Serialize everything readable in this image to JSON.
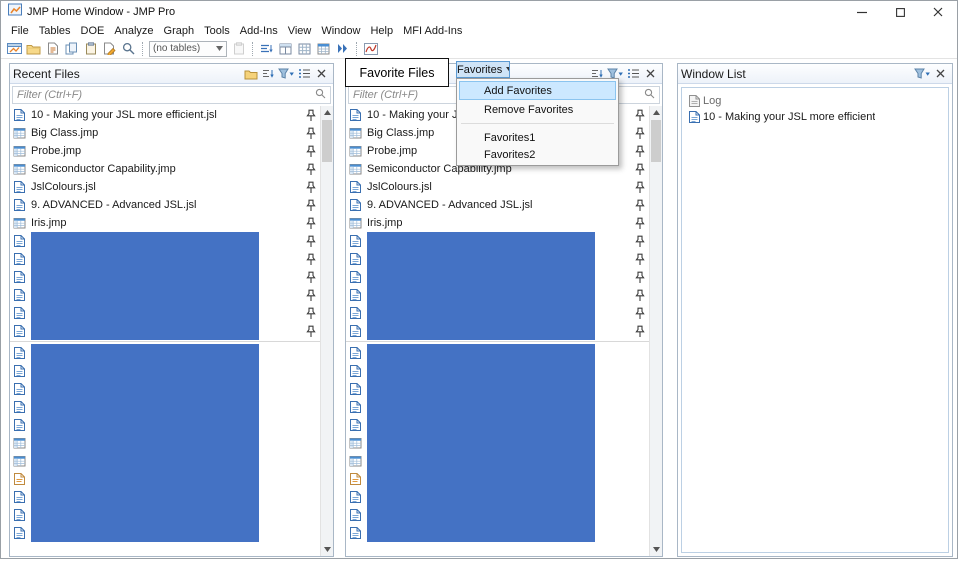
{
  "window": {
    "title": "JMP Home Window - JMP Pro"
  },
  "menu_bar": {
    "items": [
      "File",
      "Tables",
      "DOE",
      "Analyze",
      "Graph",
      "Tools",
      "Add-Ins",
      "View",
      "Window",
      "Help",
      "MFI Add-Ins"
    ]
  },
  "toolbar": {
    "tables_dropdown_label": "(no tables)"
  },
  "recent_files": {
    "title": "Recent Files",
    "filter_placeholder": "Filter (Ctrl+F)",
    "items": [
      {
        "name": "10 - Making your JSL more efficient.jsl",
        "type": "jsl",
        "pinned": true
      },
      {
        "name": "Big Class.jmp",
        "type": "jmp",
        "pinned": true
      },
      {
        "name": "Probe.jmp",
        "type": "jmp",
        "pinned": true
      },
      {
        "name": "Semiconductor Capability.jmp",
        "type": "jmp",
        "pinned": true
      },
      {
        "name": "JslColours.jsl",
        "type": "jsl",
        "pinned": true
      },
      {
        "name": "9. ADVANCED - Advanced JSL.jsl",
        "type": "jsl",
        "pinned": true
      },
      {
        "name": "Iris.jmp",
        "type": "jmp",
        "pinned": true
      },
      {
        "redacted": true,
        "type": "jsl",
        "pinned": true
      },
      {
        "redacted": true,
        "type": "jsl",
        "pinned": true
      },
      {
        "redacted": true,
        "type": "jsl",
        "pinned": true
      },
      {
        "redacted": true,
        "type": "jsl",
        "pinned": true
      },
      {
        "redacted": true,
        "type": "jsl",
        "pinned": true
      },
      {
        "redacted": true,
        "type": "jsl",
        "pinned": true
      },
      {
        "divider": true
      },
      {
        "redacted": true,
        "type": "jsl",
        "pinned": false
      },
      {
        "redacted": true,
        "type": "jsl",
        "pinned": false
      },
      {
        "redacted": true,
        "type": "jsl",
        "pinned": false
      },
      {
        "redacted": true,
        "type": "jsl",
        "pinned": false
      },
      {
        "redacted": true,
        "type": "jsl",
        "pinned": false
      },
      {
        "redacted": true,
        "type": "jmp",
        "pinned": false
      },
      {
        "redacted": true,
        "type": "jmp",
        "pinned": false
      },
      {
        "redacted": true,
        "type": "jrn",
        "pinned": false
      },
      {
        "redacted": true,
        "type": "jsl",
        "pinned": false
      },
      {
        "redacted": true,
        "type": "jsl",
        "pinned": false
      },
      {
        "redacted": true,
        "type": "jsl",
        "pinned": false
      }
    ]
  },
  "favorite_files": {
    "annotation_label": "Favorite Files",
    "favorites_button_label": "Favorites",
    "dropdown_menu": {
      "items": [
        {
          "label": "Add Favorites",
          "highlighted": true
        },
        {
          "label": "Remove Favorites"
        },
        {
          "separator": true
        },
        {
          "label": "Favorites1"
        },
        {
          "label": "Favorites2"
        }
      ]
    },
    "filter_placeholder": "Filter (Ctrl+F)",
    "items": [
      {
        "name": "10 - Making your JSL more efficient.jsl",
        "type": "jsl",
        "pinned": true
      },
      {
        "name": "Big Class.jmp",
        "type": "jmp",
        "pinned": true
      },
      {
        "name": "Probe.jmp",
        "type": "jmp",
        "pinned": true
      },
      {
        "name": "Semiconductor Capability.jmp",
        "type": "jmp",
        "pinned": true
      },
      {
        "name": "JslColours.jsl",
        "type": "jsl",
        "pinned": true
      },
      {
        "name": "9. ADVANCED - Advanced JSL.jsl",
        "type": "jsl",
        "pinned": true
      },
      {
        "name": "Iris.jmp",
        "type": "jmp",
        "pinned": true
      },
      {
        "redacted": true,
        "type": "jsl",
        "pinned": true
      },
      {
        "redacted": true,
        "type": "jsl",
        "pinned": true
      },
      {
        "redacted": true,
        "type": "jsl",
        "pinned": true
      },
      {
        "redacted": true,
        "type": "jsl",
        "pinned": true
      },
      {
        "redacted": true,
        "type": "jsl",
        "pinned": true
      },
      {
        "redacted": true,
        "type": "jsl",
        "pinned": true
      },
      {
        "divider": true
      },
      {
        "redacted": true,
        "type": "jsl",
        "pinned": false
      },
      {
        "redacted": true,
        "type": "jsl",
        "pinned": false
      },
      {
        "redacted": true,
        "type": "jsl",
        "pinned": false
      },
      {
        "redacted": true,
        "type": "jsl",
        "pinned": false
      },
      {
        "redacted": true,
        "type": "jsl",
        "pinned": false
      },
      {
        "redacted": true,
        "type": "jmp",
        "pinned": false
      },
      {
        "redacted": true,
        "type": "jmp",
        "pinned": false
      },
      {
        "redacted": true,
        "type": "jrn",
        "pinned": false
      },
      {
        "redacted": true,
        "type": "jsl",
        "pinned": false
      },
      {
        "redacted": true,
        "type": "jsl",
        "pinned": false
      },
      {
        "redacted": true,
        "type": "jsl",
        "pinned": false
      }
    ]
  },
  "window_list": {
    "title": "Window List",
    "items": [
      {
        "label": "Log",
        "type": "log"
      },
      {
        "label": "10 - Making your JSL more efficient",
        "type": "jsl"
      }
    ]
  },
  "colors": {
    "redaction_blue": "#4472c4",
    "menu_highlight": "#cce8ff",
    "accent_blue": "#2f6fb5"
  }
}
